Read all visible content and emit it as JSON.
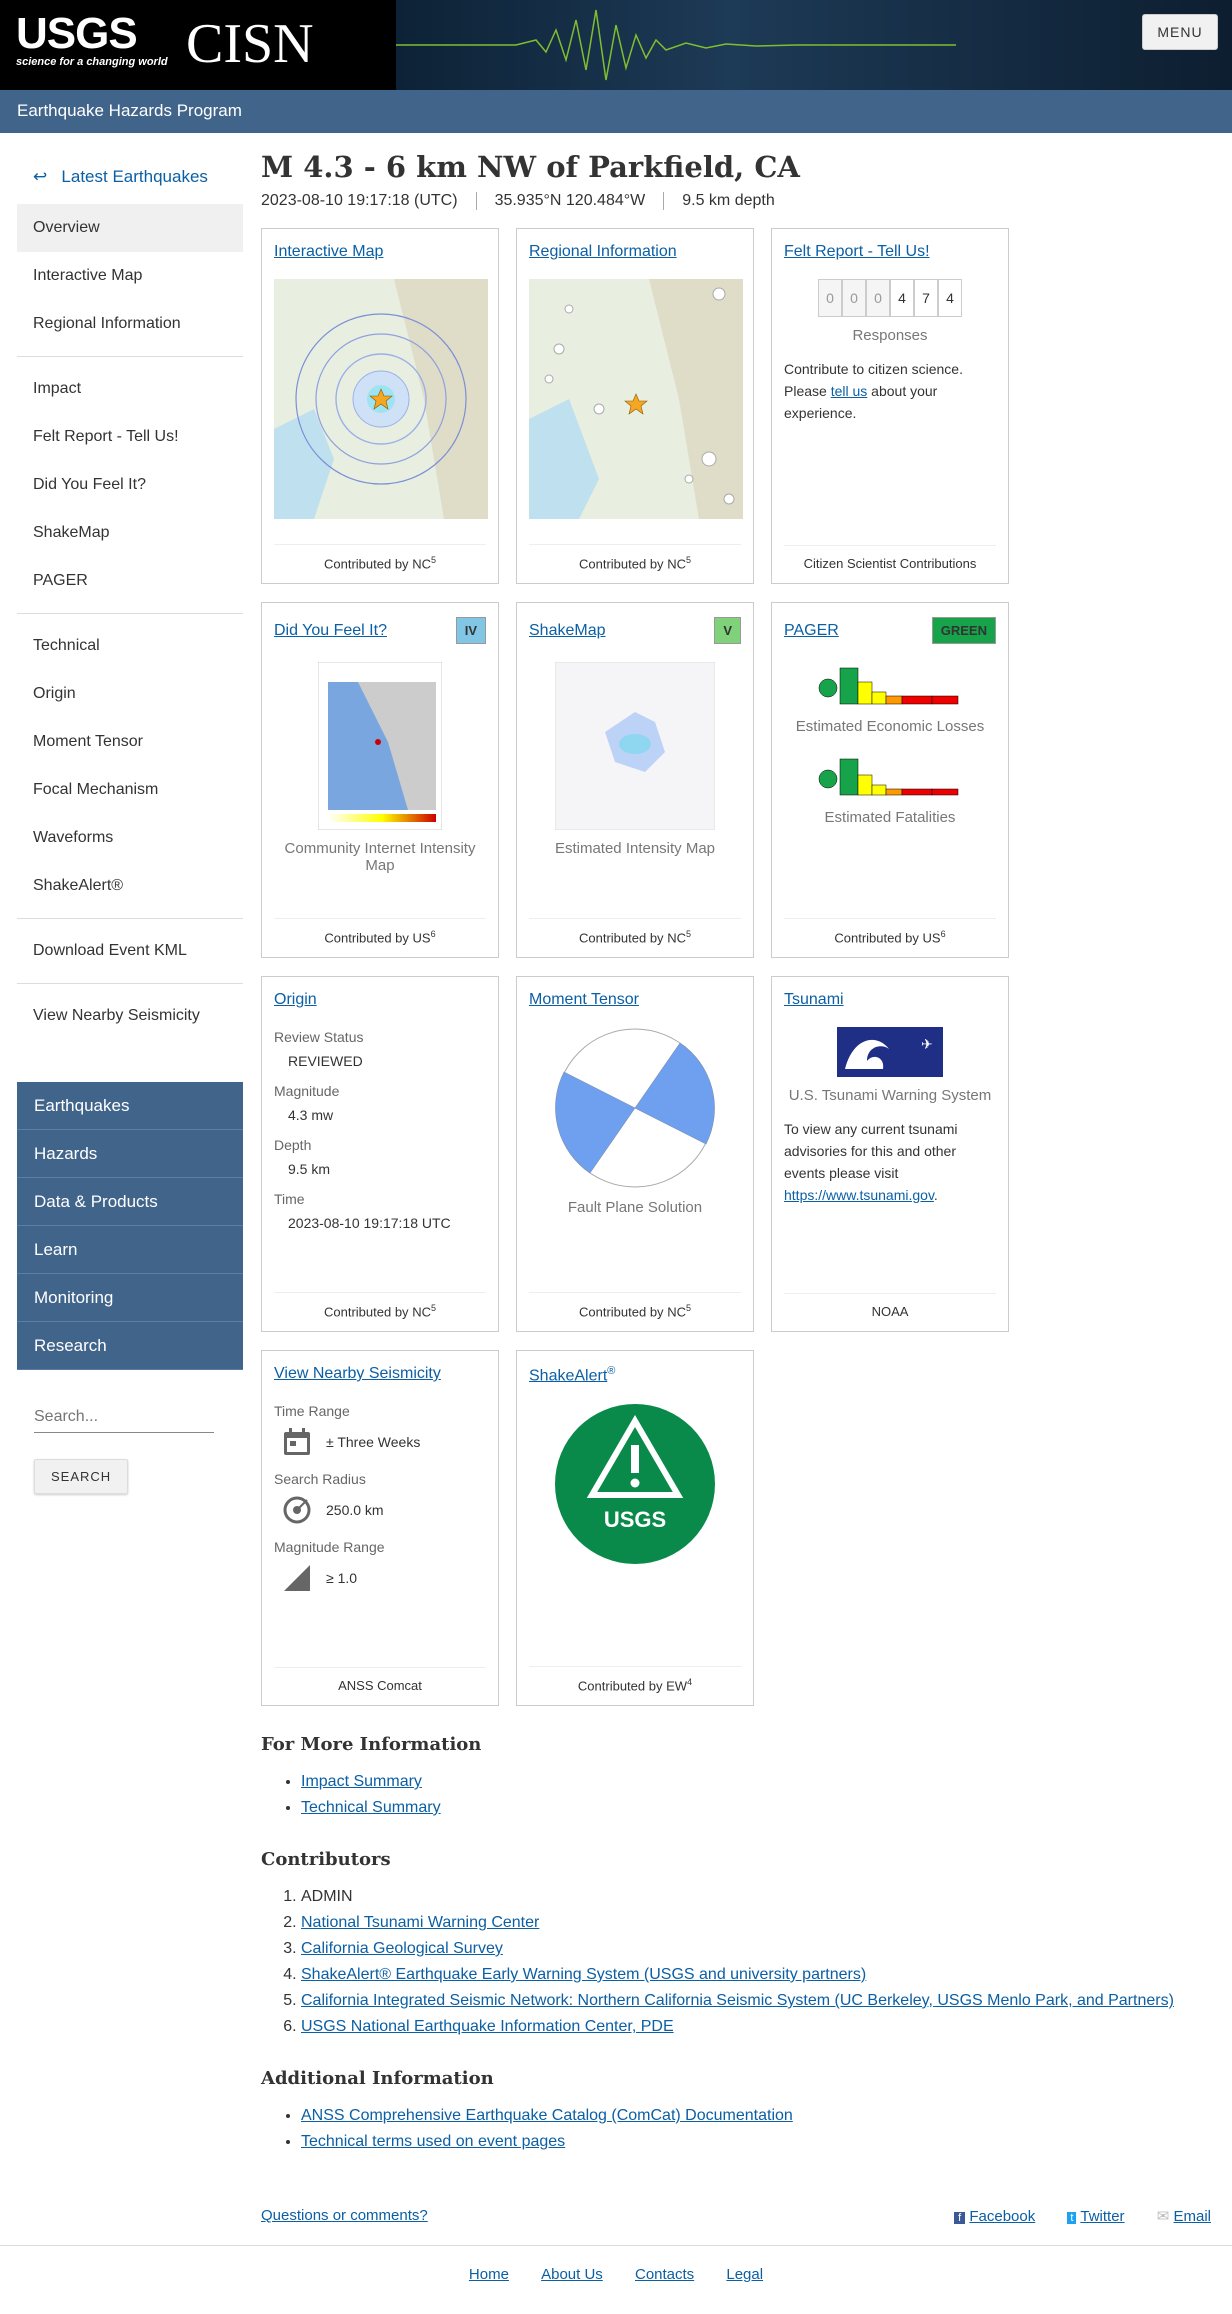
{
  "header": {
    "menu_label": "MENU",
    "usgs_logo": "USGS",
    "usgs_tagline": "science for a changing world",
    "cisn_logo": "CISN"
  },
  "subheader": {
    "title": "Earthquake Hazards Program"
  },
  "sidebar": {
    "back_label": "Latest Earthquakes",
    "group1": [
      "Overview",
      "Interactive Map",
      "Regional Information"
    ],
    "group2": [
      "Impact",
      "Felt Report - Tell Us!",
      "Did You Feel It?",
      "ShakeMap",
      "PAGER"
    ],
    "group3": [
      "Technical",
      "Origin",
      "Moment Tensor",
      "Focal Mechanism",
      "Waveforms",
      "ShakeAlert®"
    ],
    "group4": [
      "Download Event KML"
    ],
    "group5": [
      "View Nearby Seismicity"
    ],
    "nav": [
      "Earthquakes",
      "Hazards",
      "Data & Products",
      "Learn",
      "Monitoring",
      "Research"
    ],
    "search_placeholder": "Search...",
    "search_button": "SEARCH"
  },
  "event": {
    "title": "M 4.3 - 6 km NW of Parkfield, CA",
    "time": "2023-08-10 19:17:18 (UTC)",
    "location": "35.935°N 120.484°W",
    "depth": "9.5 km depth"
  },
  "cards": {
    "interactive_map": {
      "title": "Interactive Map",
      "contrib_prefix": "Contributed by",
      "contrib": "NC",
      "sup": "5"
    },
    "regional": {
      "title": "Regional Information",
      "contrib_prefix": "Contributed by",
      "contrib": "NC",
      "sup": "5"
    },
    "felt": {
      "title": "Felt Report - Tell Us!",
      "digits": [
        "0",
        "0",
        "0",
        "4",
        "7",
        "4"
      ],
      "responses": "Responses",
      "text1": "Contribute to citizen science. Please ",
      "link": "tell us",
      "text2": " about your experience.",
      "foot": "Citizen Scientist Contributions"
    },
    "dyfi": {
      "title": "Did You Feel It?",
      "badge": "IV",
      "badge_color": "#82c6e6",
      "caption": "Community Internet Intensity Map",
      "contrib_prefix": "Contributed by",
      "contrib": "US",
      "sup": "6"
    },
    "shakemap": {
      "title": "ShakeMap",
      "badge": "V",
      "badge_color": "#7fd17a",
      "caption": "Estimated Intensity Map",
      "contrib_prefix": "Contributed by",
      "contrib": "NC",
      "sup": "5"
    },
    "pager": {
      "title": "PAGER",
      "badge": "GREEN",
      "badge_color": "#16a34a",
      "caption1": "Estimated Economic Losses",
      "caption2": "Estimated Fatalities",
      "contrib_prefix": "Contributed by",
      "contrib": "US",
      "sup": "6"
    },
    "origin": {
      "title": "Origin",
      "review_label": "Review Status",
      "review": "REVIEWED",
      "mag_label": "Magnitude",
      "mag": "4.3 mw",
      "depth_label": "Depth",
      "depth": "9.5 km",
      "time_label": "Time",
      "time": "2023-08-10 19:17:18 UTC",
      "contrib_prefix": "Contributed by",
      "contrib": "NC",
      "sup": "5"
    },
    "moment": {
      "title": "Moment Tensor",
      "caption": "Fault Plane Solution",
      "contrib_prefix": "Contributed by",
      "contrib": "NC",
      "sup": "5"
    },
    "tsunami": {
      "title": "Tsunami",
      "caption": "U.S. Tsunami Warning System",
      "text": "To view any current tsunami advisories for this and other events please visit ",
      "link": "https://www.tsunami.gov",
      "foot": "NOAA"
    },
    "nearby": {
      "title": "View Nearby Seismicity",
      "time_label": "Time Range",
      "time": "± Three Weeks",
      "radius_label": "Search Radius",
      "radius": "250.0 km",
      "mag_label": "Magnitude Range",
      "mag": "≥ 1.0",
      "foot": "ANSS Comcat"
    },
    "shakealert": {
      "title": "ShakeAlert",
      "sup_title": "®",
      "logo_text": "USGS",
      "contrib_prefix": "Contributed by",
      "contrib": "EW",
      "sup": "4"
    }
  },
  "more_info": {
    "title": "For More Information",
    "links": [
      "Impact Summary",
      "Technical Summary"
    ]
  },
  "contributors": {
    "title": "Contributors",
    "first": "ADMIN",
    "links": [
      "National Tsunami Warning Center",
      "California Geological Survey",
      "ShakeAlert® Earthquake Early Warning System (USGS and university partners)",
      "California Integrated Seismic Network: Northern California Seismic System (UC Berkeley, USGS Menlo Park, and Partners)",
      "USGS National Earthquake Information Center, PDE"
    ]
  },
  "additional": {
    "title": "Additional Information",
    "links": [
      "ANSS Comprehensive Earthquake Catalog (ComCat) Documentation",
      "Technical terms used on event pages"
    ]
  },
  "feedback": {
    "question": "Questions or comments?",
    "facebook": "Facebook",
    "twitter": "Twitter",
    "email": "Email"
  },
  "footer": {
    "links": [
      "Home",
      "About Us",
      "Contacts",
      "Legal"
    ]
  }
}
